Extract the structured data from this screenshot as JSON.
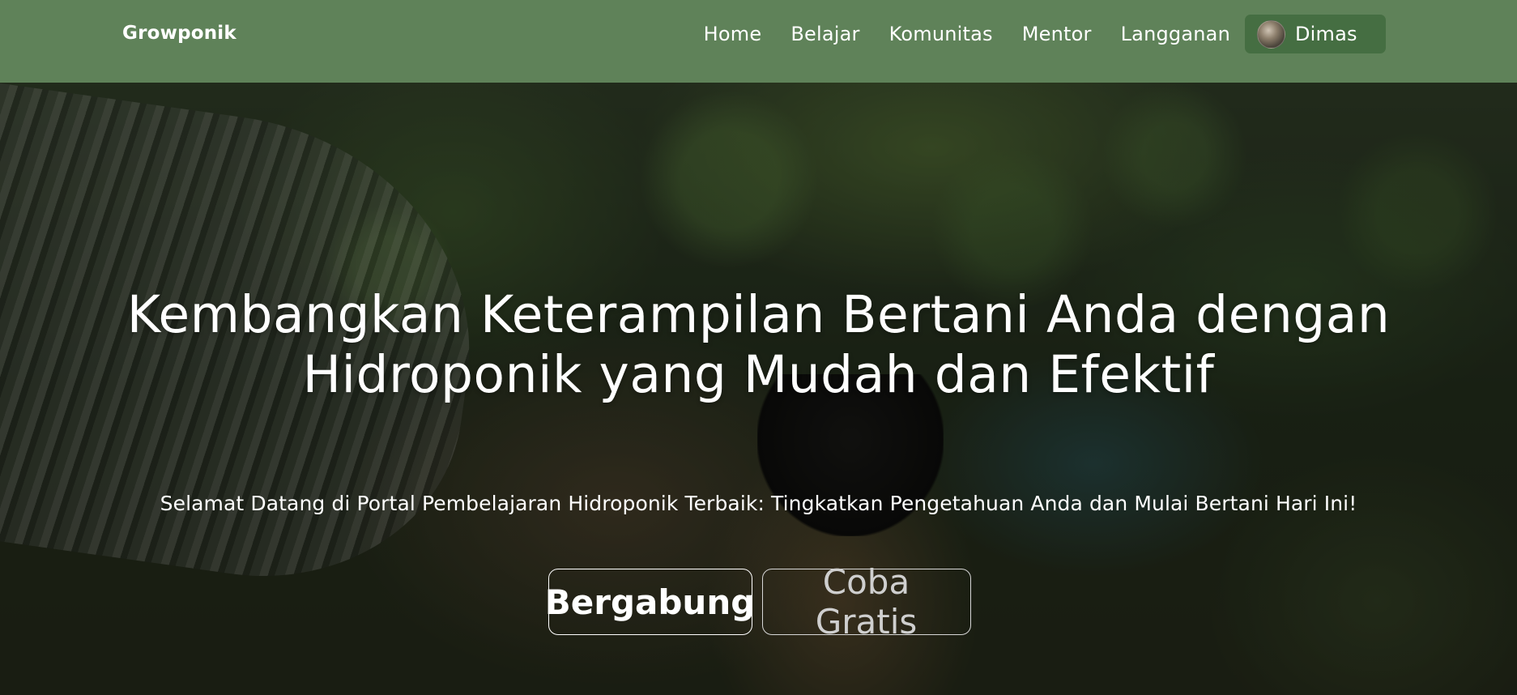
{
  "navbar": {
    "brand": "Growponik",
    "links": [
      "Home",
      "Belajar",
      "Komunitas",
      "Mentor",
      "Langganan"
    ],
    "profile": {
      "name": "Dimas",
      "avatar_icon": "user-avatar"
    },
    "background_color": "#5f8259",
    "profile_chip_color": "#456e42"
  },
  "hero": {
    "title": "Kembangkan Keterampilan Bertani Anda dengan Hidroponik yang Mudah dan Efektif",
    "subtitle": "Selamat Datang di Portal Pembelajaran Hidroponik Terbaik: Tingkatkan Pengetahuan Anda dan Mulai Bertani Hari Ini!",
    "buttons": {
      "primary": "Bergabung",
      "secondary": "Coba Gratis"
    }
  }
}
